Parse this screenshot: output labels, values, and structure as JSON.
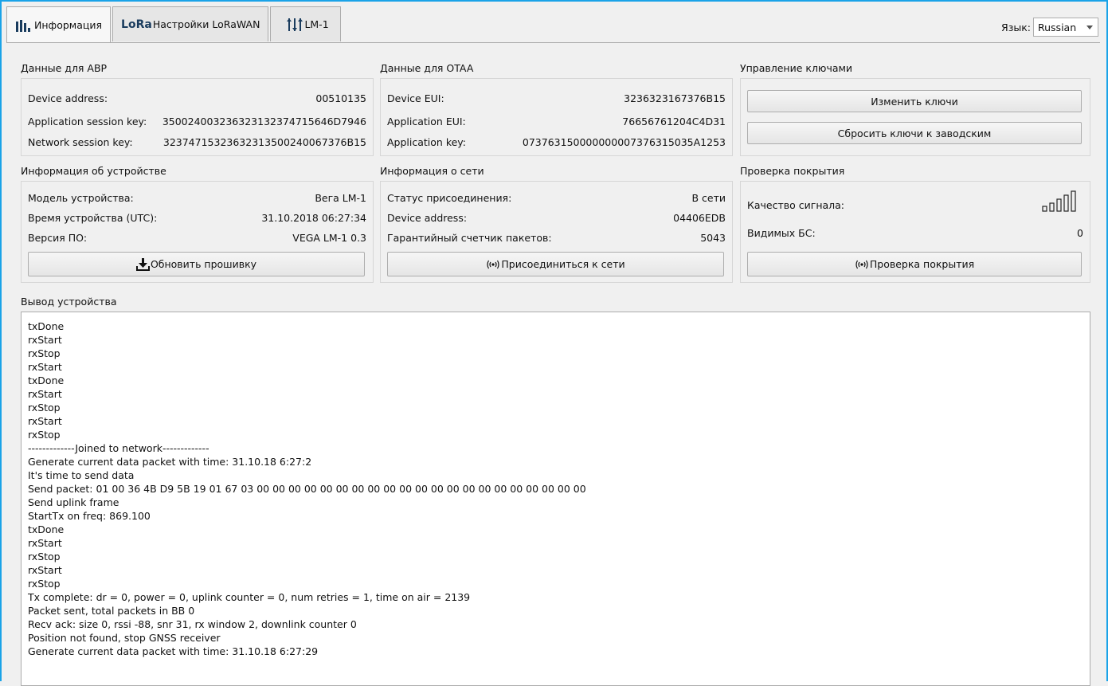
{
  "tabs": [
    {
      "label": "Информация"
    },
    {
      "label": "Настройки LoRaWAN",
      "logo_text": "LoRa"
    },
    {
      "label": "LM-1"
    }
  ],
  "language": {
    "label": "Язык:",
    "value": "Russian"
  },
  "abp": {
    "title": "Данные для ABP",
    "rows": [
      {
        "label": "Device address:",
        "value": "00510135"
      },
      {
        "label": "Application session key:",
        "value": "35002400323632313237471564​6D7946"
      },
      {
        "label": "Network session key:",
        "value": "3237471532363231350024006737​6B15"
      }
    ]
  },
  "otaa": {
    "title": "Данные для OTAA",
    "rows": [
      {
        "label": "Device EUI:",
        "value": "3236323167376B15"
      },
      {
        "label": "Application EUI:",
        "value": "76656761204C4D31"
      },
      {
        "label": "Application key:",
        "value": "07376315000000000737631503​5A1253"
      }
    ]
  },
  "keys": {
    "title": "Управление ключами",
    "change_label": "Изменить ключи",
    "reset_label": "Сбросить ключи к заводским"
  },
  "device": {
    "title": "Информация об устройстве",
    "rows": [
      {
        "label": "Модель устройства:",
        "value": "Вега LM-1"
      },
      {
        "label": "Время устройства (UTC):",
        "value": "31.10.2018 06:27:34"
      },
      {
        "label": "Версия ПО:",
        "value": "VEGA LM-1 0.3"
      }
    ],
    "update_label": "Обновить прошивку"
  },
  "network": {
    "title": "Информация о сети",
    "rows": [
      {
        "label": "Статус присоединения:",
        "value": "В сети"
      },
      {
        "label": "Device address:",
        "value": "04406EDB"
      },
      {
        "label": "Гарантийный счетчик пакетов:",
        "value": "5043"
      }
    ],
    "join_label": "Присоединиться к сети"
  },
  "coverage": {
    "title": "Проверка покрытия",
    "signal_label": "Качество сигнала:",
    "signal_bars": 5,
    "stations_label": "Видимых БС:",
    "stations_value": "0",
    "check_label": "Проверка покрытия"
  },
  "output": {
    "title": "Вывод устройства",
    "lines": [
      "txDone",
      "rxStart",
      "rxStop",
      "rxStart",
      "txDone",
      "rxStart",
      "rxStop",
      "rxStart",
      "rxStop",
      "-------------Joined to network-------------",
      "Generate current data packet with time: 31.10.18 6:27:2",
      "It's time to send data",
      "Send packet: 01 00 36 4B D9 5B 19 01 67 03 00 00 00 00 00 00 00 00 00 00 00 00 00 00 00 00 00 00 00 00 00",
      "Send uplink frame",
      "StartTx on freq: 869.100",
      "txDone",
      "rxStart",
      "rxStop",
      "rxStart",
      "rxStop",
      "Tx complete: dr = 0, power = 0, uplink counter = 0, num retries = 1, time on air = 2139",
      "Packet sent, total packets in BB 0",
      "Recv ack: size 0, rssi -88, snr 31, rx window 2, downlink counter 0",
      "Position not found, stop GNSS receiver",
      "Generate current data packet with time: 31.10.18 6:27:29"
    ]
  },
  "colors": {
    "accent_border": "#1aa3e8",
    "lora_logo": "#1a3c5e"
  }
}
